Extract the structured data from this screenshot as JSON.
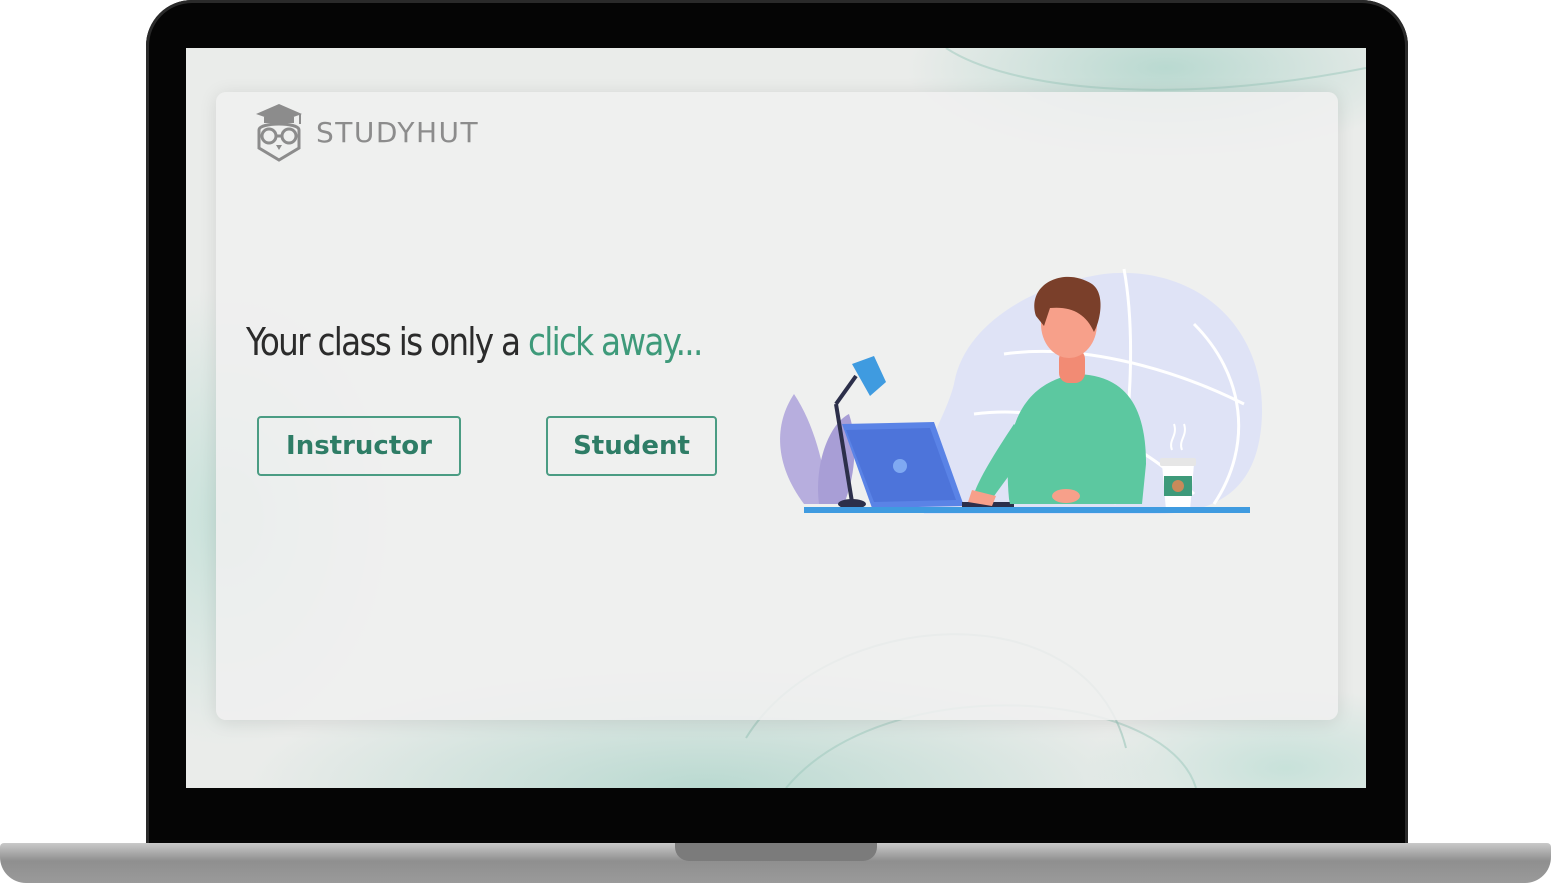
{
  "brand": {
    "name": "STUDYHUT",
    "logo_icon": "owl-graduation-cap-icon"
  },
  "hero": {
    "headline_prefix": "Your class is only a ",
    "headline_accent": "click away...",
    "illustration_icon": "student-at-laptop-illustration"
  },
  "actions": {
    "instructor_label": "Instructor",
    "student_label": "Student"
  },
  "colors": {
    "accent": "#3e9a7a",
    "button_border": "#4a9c83",
    "button_text": "#2e7d66",
    "headline_text": "#2b2b2b",
    "brand_text": "#8c8c8c",
    "card_background": "#f0f0f0"
  }
}
